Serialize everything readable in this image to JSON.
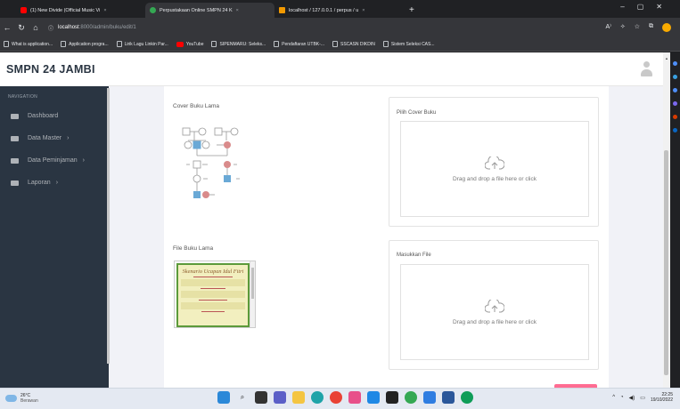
{
  "browser": {
    "tabs": [
      {
        "title": "(1) New Divide (Official Music Vi",
        "icon_color": "#ff0000",
        "active": false
      },
      {
        "title": "Perpustakaan Online SMPN 24 K",
        "icon_color": "#34a853",
        "active": true
      },
      {
        "title": "localhost / 127.0.0.1 / perpus / u",
        "icon_color": "#f29900",
        "active": false
      }
    ],
    "new_tab_label": "+",
    "url_host": "localhost",
    "url_path": ":8000/admin/buku/edit/1",
    "bookmarks": [
      {
        "label": "What is application..."
      },
      {
        "label": "Application progra..."
      },
      {
        "label": "Lirik Lagu Linkin Par..."
      },
      {
        "label": "YouTube",
        "youtube": true
      },
      {
        "label": "SIPENMARU: Seleks..."
      },
      {
        "label": "Pendaftaran UTBK-..."
      },
      {
        "label": "SSCASN DIKDIN"
      },
      {
        "label": "Sistem Seleksi CAS..."
      }
    ]
  },
  "app": {
    "brand": "SMPN 24 JAMBI",
    "nav_label": "NAVIGATION",
    "nav_items": [
      {
        "label": "Dashboard",
        "has_children": false
      },
      {
        "label": "Data Master",
        "has_children": true
      },
      {
        "label": "Data Peminjaman",
        "has_children": true
      },
      {
        "label": "Laporan",
        "has_children": true
      }
    ],
    "chevron": "›"
  },
  "form": {
    "cover_old_title": "Cover Buku Lama",
    "cover_pick_title": "Pilih Cover Buku",
    "cover_drop_text": "Drag and drop a file here or click",
    "file_old_title": "File Buku Lama",
    "file_input_title": "Masukkan File",
    "file_drop_text": "Drag and drop a file here or click",
    "pdf_preview_title": "Skenario Ucapan Idul Fitri"
  },
  "taskbar": {
    "temperature": "26°C",
    "weather": "Berawan",
    "time": "22:25",
    "date": "19/10/2022"
  },
  "colors": {
    "sidebar": "#2a3542",
    "accent_pink": "#ff6c92",
    "background": "#f1f2f7"
  }
}
